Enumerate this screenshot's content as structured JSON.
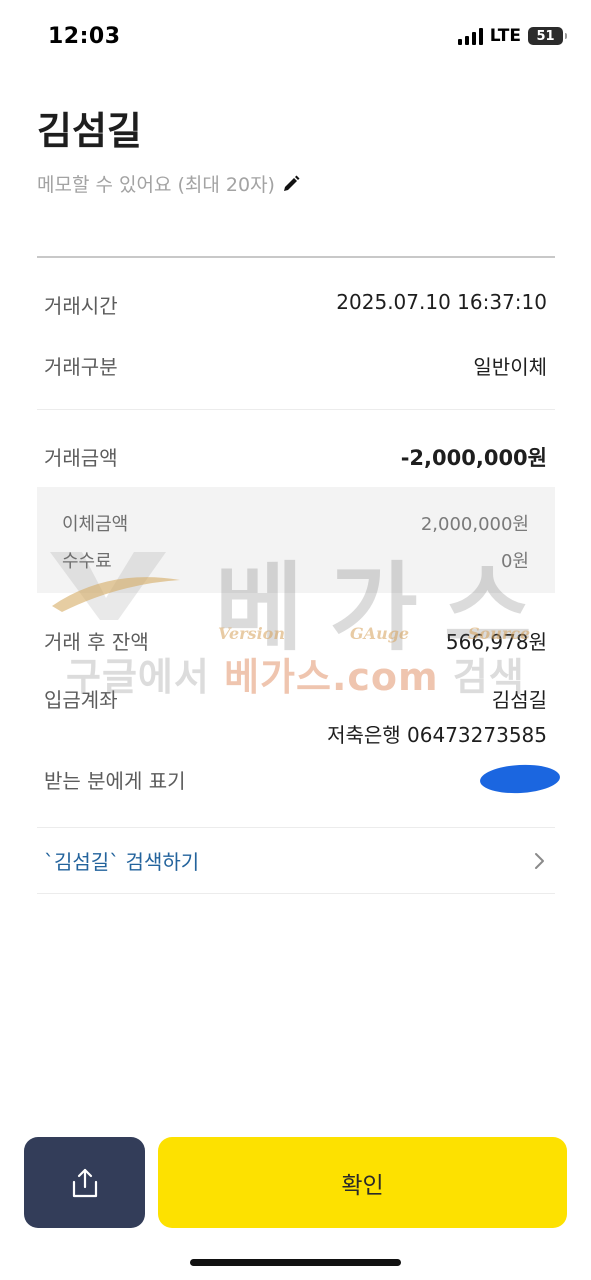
{
  "status_bar": {
    "time": "12:03",
    "network": "LTE",
    "battery": "51",
    "icons": [
      "signal-bars-icon",
      "battery-icon"
    ]
  },
  "header": {
    "title": "김섬길",
    "memo_placeholder": "메모할 수 있어요 (최대 20자)",
    "memo_icon": "pencil-icon"
  },
  "transaction": {
    "time_label": "거래시간",
    "time_value": "2025.07.10 16:37:10",
    "type_label": "거래구분",
    "type_value": "일반이체",
    "amount_label": "거래금액",
    "amount_value": "-2,000,000원",
    "transfer_amount_label": "이체금액",
    "transfer_amount_value": "2,000,000원",
    "fee_label": "수수료",
    "fee_value": "0원",
    "balance_label": "거래 후 잔액",
    "balance_value": "566,978원",
    "deposit_account_label": "입금계좌",
    "deposit_account_name": "김섬길",
    "deposit_account_number": "저축은행 06473273585",
    "recipient_display_label": "받는 분에게 표기"
  },
  "search_link": {
    "label": "`김섬길` 검색하기",
    "icon": "chevron-right-icon"
  },
  "watermark": {
    "big_text": "베가스",
    "word_version": "Version",
    "word_gauge": "GAuge",
    "word_source": "Source",
    "search_prefix": "구글에서 ",
    "search_accent": "베가스.com",
    "search_suffix": " 검색"
  },
  "buttons": {
    "share_icon": "share-icon",
    "confirm_label": "확인"
  },
  "colors": {
    "confirm": "#fde100",
    "share": "#333d59",
    "link": "#23639c",
    "redaction": "#1b66e0"
  }
}
